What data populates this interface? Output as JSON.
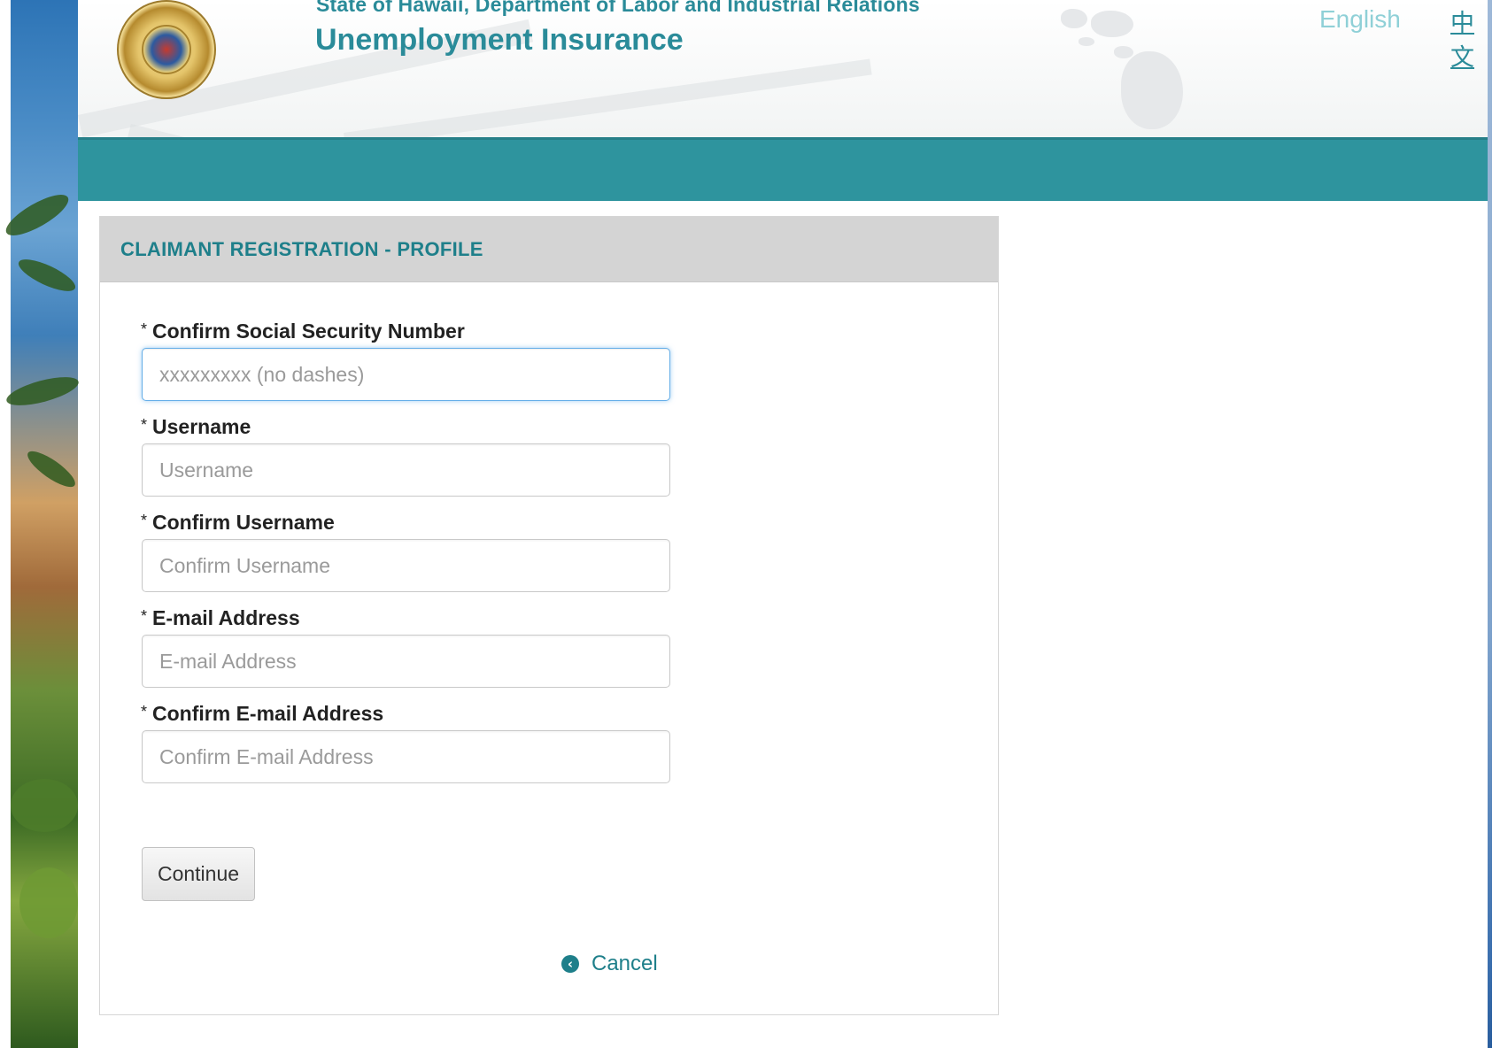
{
  "header": {
    "agency": "State of Hawaii, Department of Labor and Industrial Relations",
    "product": "Unemployment Insurance",
    "seal_icon": "state-seal-icon",
    "languages": [
      "English",
      "中文"
    ]
  },
  "panel": {
    "title": "CLAIMANT REGISTRATION - PROFILE"
  },
  "form": {
    "required_marker": "*",
    "fields": [
      {
        "label": "Confirm Social Security Number",
        "placeholder": "xxxxxxxxx (no dashes)",
        "value": ""
      },
      {
        "label": "Username",
        "placeholder": "Username",
        "value": ""
      },
      {
        "label": "Confirm Username",
        "placeholder": "Confirm Username",
        "value": ""
      },
      {
        "label": "E-mail Address",
        "placeholder": "E-mail Address",
        "value": ""
      },
      {
        "label": "Confirm E-mail Address",
        "placeholder": "Confirm E-mail Address",
        "value": ""
      }
    ],
    "continue_label": "Continue",
    "cancel_label": "Cancel",
    "cancel_icon": "circle-arrow-left-icon"
  },
  "colors": {
    "brand_teal": "#2e949e",
    "title_teal": "#1e7f8a",
    "panel_header_bg": "#d4d4d4"
  }
}
